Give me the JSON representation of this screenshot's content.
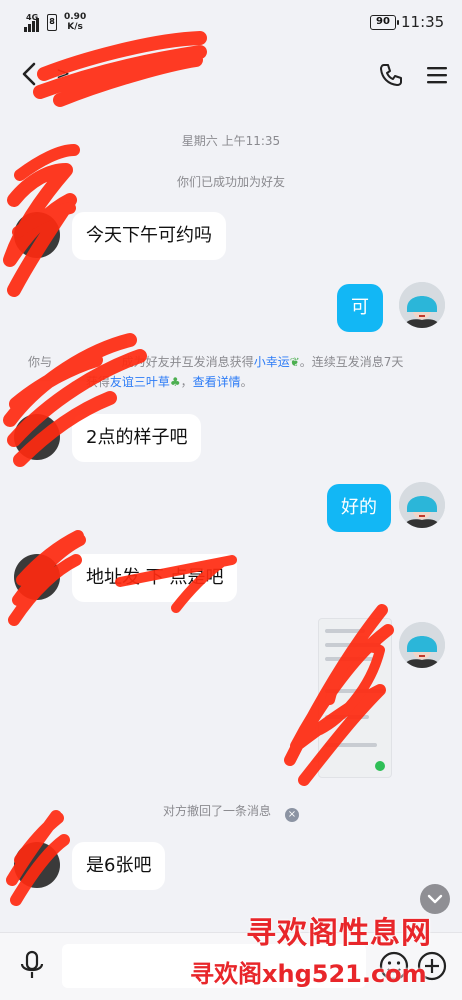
{
  "status_bar": {
    "signal_label": "4G",
    "sim_label": "8",
    "speed_value": "0.90",
    "speed_unit": "K/s",
    "battery": "90",
    "time": "11:35"
  },
  "header": {
    "contact_name_fragment": "> ",
    "back_icon": "chevron-left-icon",
    "call_icon": "phone-icon",
    "menu_icon": "menu-icon"
  },
  "chat": {
    "timestamp": "星期六 上午11:35",
    "system_added": "你们已成功加为好友",
    "messages": [
      {
        "side": "left",
        "text": "今天下午可约吗"
      },
      {
        "side": "right",
        "text": "可"
      },
      {
        "side": "left",
        "text": "2点的样子吧"
      },
      {
        "side": "right",
        "text": "好的"
      },
      {
        "side": "left",
        "text": "地址发 下 点是吧"
      },
      {
        "side": "left",
        "text": "是6张吧"
      }
    ],
    "notice": {
      "part1": "你与",
      "part2": "成为好友并互发消息获得",
      "link1": "小幸运",
      "part3": "。连续互发消息7天",
      "part4": "获得",
      "link2": "友谊三叶草",
      "part5": "，",
      "link3": "查看详情",
      "part6": "。"
    },
    "recall_text": "对方撤回了一条消息",
    "recall_close": "×"
  },
  "input_bar": {
    "mic_icon": "microphone-icon",
    "emoji_icon": "emoji-icon",
    "plus_icon": "plus-icon"
  },
  "watermark": {
    "line1": "寻欢阁性息网",
    "line2": "寻欢阁xhg521.com"
  },
  "colors": {
    "bubble_right": "#12b7f5",
    "link": "#2d7cf6",
    "scribble": "#ff2a10"
  }
}
